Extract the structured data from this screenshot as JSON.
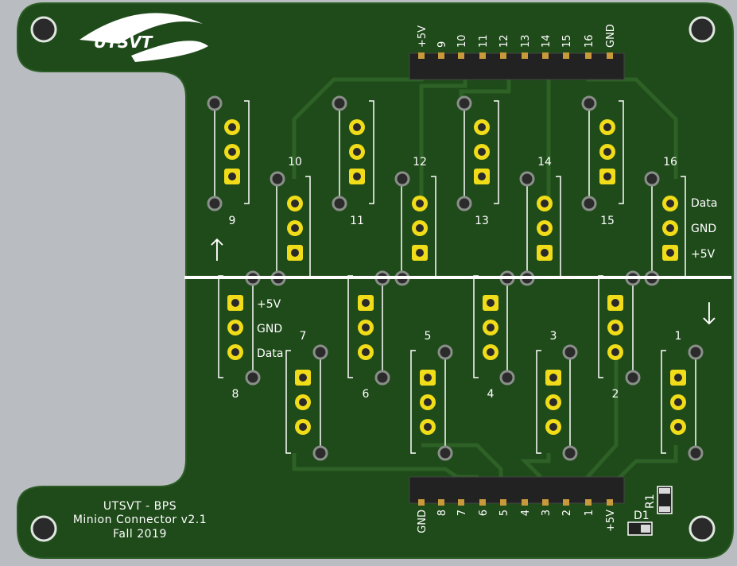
{
  "colors": {
    "background": "#b9bcc0",
    "board": "#1f4a1a",
    "trace": "#2d6126",
    "pad": "#f0dc18",
    "silkscreen": "#ffffff"
  },
  "logo": {
    "text": "UTSVT"
  },
  "board_note": {
    "line1": "UTSVT - BPS",
    "line2": "Minion Connector v2.1",
    "line3": "Fall 2019"
  },
  "top_header": {
    "labels": [
      "+5V",
      "9",
      "10",
      "11",
      "12",
      "13",
      "14",
      "15",
      "16",
      "GND"
    ]
  },
  "bottom_header": {
    "labels": [
      "GND",
      "8",
      "7",
      "6",
      "5",
      "4",
      "3",
      "2",
      "1",
      "+5V"
    ]
  },
  "upper_connectors": [
    {
      "label": "9"
    },
    {
      "label": "10"
    },
    {
      "label": "11"
    },
    {
      "label": "12"
    },
    {
      "label": "13"
    },
    {
      "label": "14"
    },
    {
      "label": "15"
    },
    {
      "label": "16"
    }
  ],
  "lower_connectors": [
    {
      "label": "8"
    },
    {
      "label": "7"
    },
    {
      "label": "6"
    },
    {
      "label": "5"
    },
    {
      "label": "4"
    },
    {
      "label": "3"
    },
    {
      "label": "2"
    },
    {
      "label": "1"
    }
  ],
  "pin_labels_right": {
    "data": "Data",
    "gnd": "GND",
    "v5": "+5V"
  },
  "pin_labels_left": {
    "v5": "+5V",
    "gnd": "GND",
    "data": "Data"
  },
  "parts": {
    "r1": "R1",
    "d1": "D1"
  },
  "arrows": {
    "up": "↑",
    "down": "↓"
  }
}
